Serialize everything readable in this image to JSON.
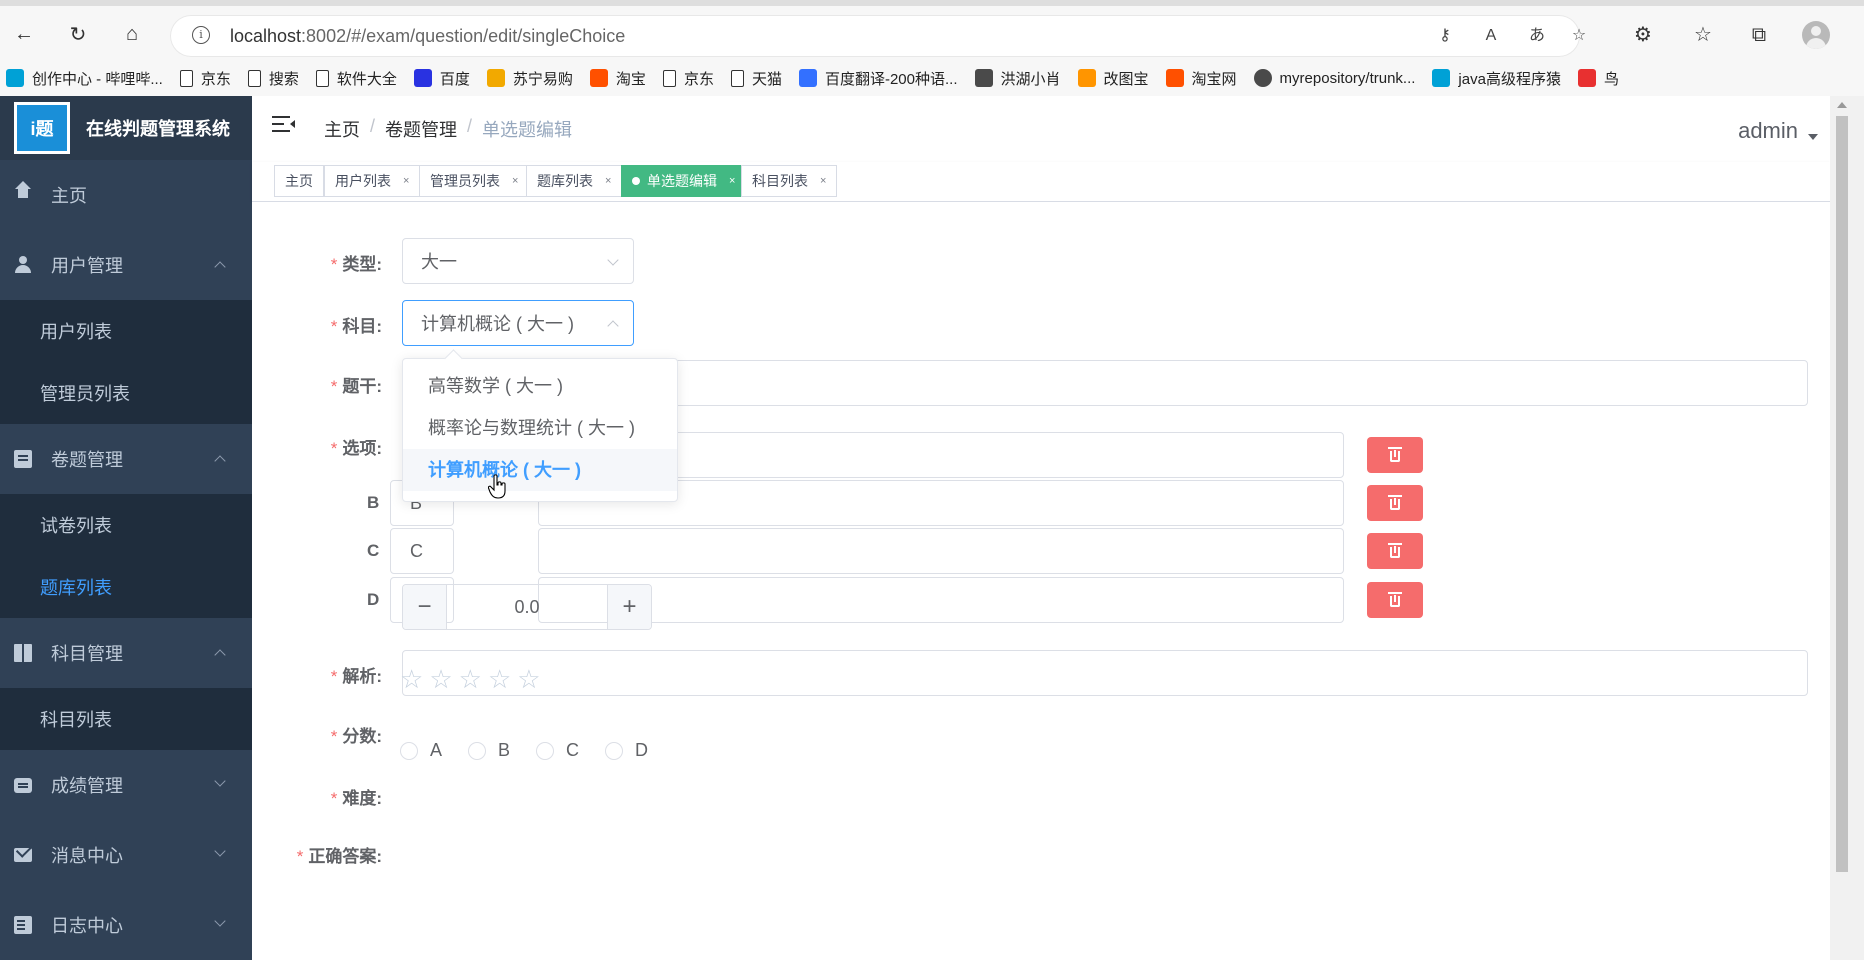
{
  "browser": {
    "url_host": "localhost",
    "url_path": ":8002/#/exam/question/edit/singleChoice",
    "bookmarks": [
      {
        "label": "创作中心 - 哔哩哔...",
        "icon": "bilibili-icon",
        "color": "#00a1d6"
      },
      {
        "label": "京东",
        "icon": "page-icon"
      },
      {
        "label": "搜索",
        "icon": "page-icon"
      },
      {
        "label": "软件大全",
        "icon": "page-icon"
      },
      {
        "label": "百度",
        "icon": "baidu-paw-icon",
        "color": "#2932e1"
      },
      {
        "label": "苏宁易购",
        "icon": "suning-icon",
        "color": "#f2a900"
      },
      {
        "label": "淘宝",
        "icon": "taobao-icon",
        "color": "#ff5000"
      },
      {
        "label": "京东",
        "icon": "page-icon"
      },
      {
        "label": "天猫",
        "icon": "page-icon"
      },
      {
        "label": "百度翻译-200种语...",
        "icon": "translate-icon",
        "color": "#3370ff"
      },
      {
        "label": "洪湖小肖",
        "icon": "bird-icon"
      },
      {
        "label": "改图宝",
        "icon": "gaitubao-icon",
        "color": "#ff9500"
      },
      {
        "label": "淘宝网",
        "icon": "taobao-icon",
        "color": "#ff5000"
      },
      {
        "label": "myrepository/trunk...",
        "icon": "chrome-icon"
      },
      {
        "label": "java高级程序猿",
        "icon": "bilibili-icon",
        "color": "#00a1d6"
      },
      {
        "label": "鸟",
        "icon": "bird-red-icon",
        "color": "#e83030"
      }
    ]
  },
  "app": {
    "title": "在线判题管理系统",
    "logo_text": "i题",
    "user": "admin"
  },
  "sidebar": {
    "menu": [
      {
        "label": "主页",
        "icon": "home-icon",
        "expanded": null
      },
      {
        "label": "用户管理",
        "icon": "user-icon",
        "expanded": true,
        "children": [
          "用户列表",
          "管理员列表"
        ]
      },
      {
        "label": "卷题管理",
        "icon": "document-icon",
        "expanded": true,
        "children": [
          "试卷列表",
          "题库列表"
        ]
      },
      {
        "label": "科目管理",
        "icon": "book-icon",
        "expanded": true,
        "children": [
          "科目列表"
        ]
      },
      {
        "label": "成绩管理",
        "icon": "chat-icon",
        "expanded": false
      },
      {
        "label": "消息中心",
        "icon": "mail-icon",
        "expanded": false
      },
      {
        "label": "日志中心",
        "icon": "log-icon",
        "expanded": false
      }
    ],
    "active_child": "题库列表"
  },
  "breadcrumb": [
    "主页",
    "卷题管理",
    "单选题编辑"
  ],
  "tags": [
    {
      "label": "主页",
      "active": false,
      "closable": false
    },
    {
      "label": "用户列表",
      "active": false,
      "closable": true
    },
    {
      "label": "管理员列表",
      "active": false,
      "closable": true
    },
    {
      "label": "题库列表",
      "active": false,
      "closable": true
    },
    {
      "label": "单选题编辑",
      "active": true,
      "closable": true
    },
    {
      "label": "科目列表",
      "active": false,
      "closable": true
    }
  ],
  "form": {
    "type_label": "类型:",
    "type_value": "大一",
    "subject_label": "科目:",
    "subject_value": "计算机概论 ( 大一 )",
    "stem_label": "题干:",
    "options_label": "选项:",
    "options": [
      {
        "prefix": "B",
        "letter": "B"
      },
      {
        "prefix": "C",
        "letter": "C"
      },
      {
        "prefix": "D",
        "letter": "D"
      }
    ],
    "analysis_label": "解析:",
    "score_label": "分数:",
    "score_value": "0.0",
    "difficulty_label": "难度:",
    "difficulty_stars": 0,
    "difficulty_max": 5,
    "answer_label": "正确答案:",
    "answers": [
      "A",
      "B",
      "C",
      "D"
    ]
  },
  "dropdown": {
    "items": [
      "高等数学 ( 大一 )",
      "概率论与数理统计 ( 大一 )",
      "计算机概论 ( 大一 )"
    ],
    "selected_index": 2
  },
  "colors": {
    "sidebar_bg": "#304156",
    "active_tag": "#42b983",
    "primary": "#409eff",
    "danger": "#f56c6c"
  }
}
